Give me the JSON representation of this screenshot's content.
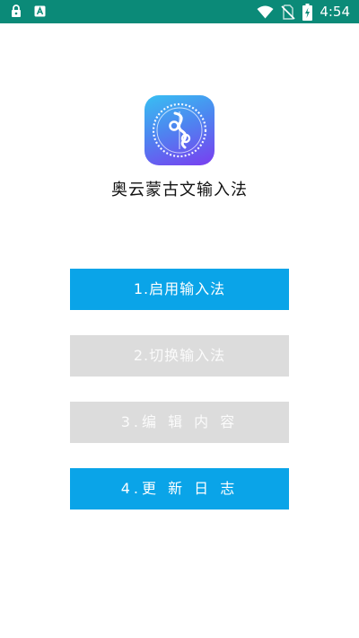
{
  "status_bar": {
    "time": "4:54",
    "icons": [
      "lock-icon",
      "font-icon",
      "wifi-icon",
      "no-sim-icon",
      "battery-charging-icon"
    ]
  },
  "app": {
    "logo_icon": "mongolian-script-logo-icon",
    "title": "奥云蒙古文输入法"
  },
  "menu": {
    "enable_label": "1.启用输入法",
    "switch_label": "2.切换输入法",
    "edit_label": "3.编 辑 内 容",
    "changelog_label": "4.更 新 日 志"
  },
  "colors": {
    "status_bar": "#0b8a78",
    "button_active": "#0aa4e8",
    "button_disabled": "#dcdcdc"
  }
}
